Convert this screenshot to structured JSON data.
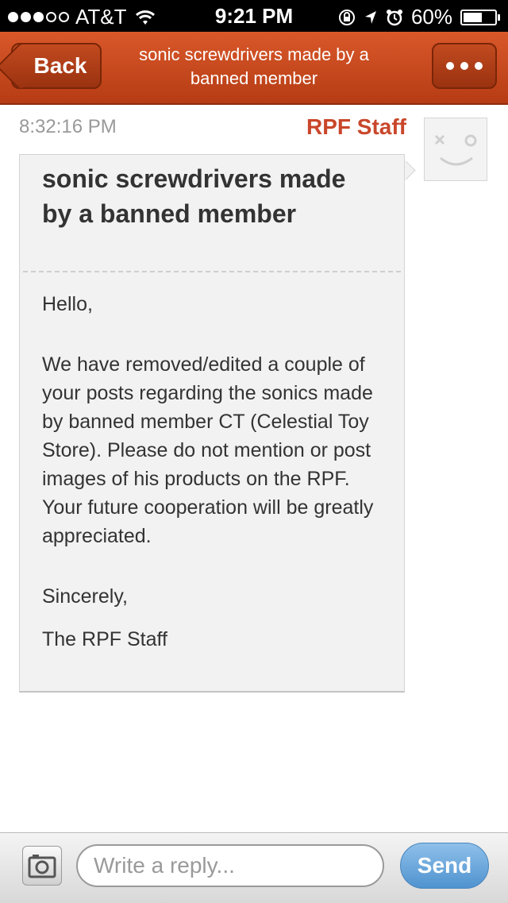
{
  "status_bar": {
    "carrier": "AT&T",
    "signal_bars_filled": 3,
    "signal_bars_total": 5,
    "time": "9:21 PM",
    "battery_percent": "60%",
    "battery_level": 0.6,
    "icons": [
      "wifi-icon",
      "rotation-lock-icon",
      "location-icon",
      "alarm-icon",
      "battery-icon"
    ]
  },
  "nav": {
    "back_label": "Back",
    "title": "sonic screwdrivers made by a banned member",
    "more_icon": "more-dots-icon",
    "accent_color": "#c9462a"
  },
  "message": {
    "timestamp": "8:32:16 PM",
    "sender": "RPF Staff",
    "avatar_icon": "default-face-avatar-icon",
    "title": "sonic screwdrivers made by a banned member",
    "greeting": "Hello,",
    "body": "We have removed/edited a couple of your posts regarding the sonics made by banned member CT (Celestial Toy Store). Please do not mention or post images of his products on the RPF. Your future cooperation will be greatly appreciated.",
    "closing": "Sincerely,",
    "signature": "The RPF Staff"
  },
  "reply": {
    "camera_icon": "camera-icon",
    "placeholder": "Write a reply...",
    "value": "",
    "send_label": "Send",
    "send_color": "#5a9ad3"
  }
}
